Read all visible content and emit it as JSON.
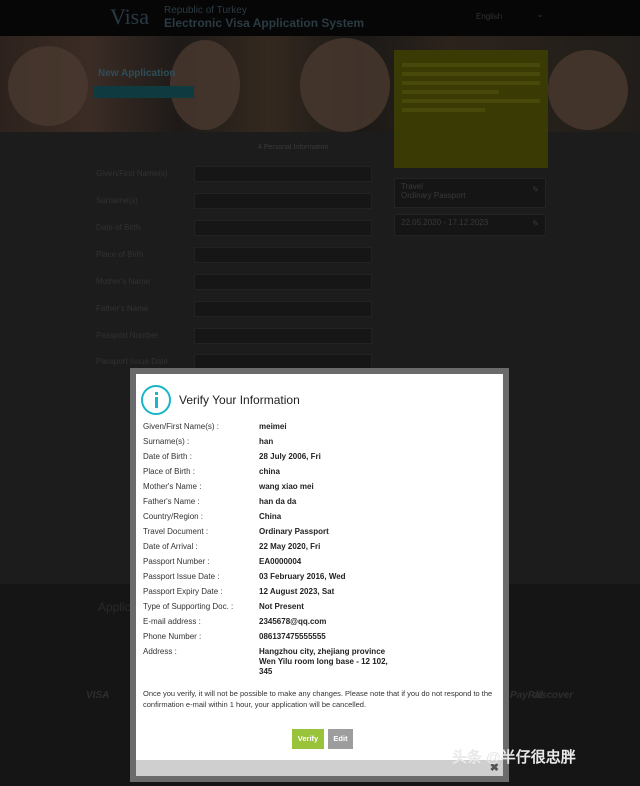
{
  "header": {
    "brand": "Visa",
    "republic": "Republic of Turkey",
    "system": "Electronic Visa Application System",
    "language": "English"
  },
  "banner": {
    "title": "New Application"
  },
  "breadcrumb": "4 Personal Information",
  "form": {
    "labels": [
      "Given/First Name(s)",
      "Surname(s)",
      "Date of Birth",
      "Place of Birth",
      "Mother's Name",
      "Father's Name",
      "Passport Number",
      "Passport Issue Date",
      "Passport Expiry Date",
      "Type of Supporting Doc.",
      "E-mail address",
      "Phone Number",
      "Address"
    ],
    "values": [
      "meimei",
      "han",
      "28 July 2006, Fri",
      "china",
      "wang xiao mei",
      "han da da",
      "EA0000004",
      "03 February 2016, Wed",
      "",
      "",
      "",
      "",
      ""
    ]
  },
  "side": {
    "travel_doc_label": "Travel",
    "travel_doc_value": "Ordinary Passport",
    "dates": "22.05.2020 - 17.12.2023"
  },
  "footer": {
    "title": "Application",
    "payments": [
      "VISA",
      "MasterCard",
      "PayPal",
      "discover"
    ]
  },
  "modal": {
    "title": "Verify Your Information",
    "rows": [
      {
        "label": "Given/First Name(s) :",
        "value": "meimei"
      },
      {
        "label": "Surname(s) :",
        "value": "han"
      },
      {
        "label": "Date of Birth :",
        "value": "28 July 2006, Fri"
      },
      {
        "label": "Place of Birth :",
        "value": "china"
      },
      {
        "label": "Mother's Name :",
        "value": "wang xiao mei"
      },
      {
        "label": "Father's Name :",
        "value": "han da da"
      },
      {
        "label": "Country/Region :",
        "value": "China"
      },
      {
        "label": "Travel Document :",
        "value": "Ordinary Passport"
      },
      {
        "label": "Date of Arrival :",
        "value": "22 May 2020, Fri"
      },
      {
        "label": "Passport Number :",
        "value": "EA0000004"
      },
      {
        "label": "Passport Issue Date :",
        "value": "03 February 2016, Wed"
      },
      {
        "label": "Passport Expiry Date :",
        "value": "12 August 2023, Sat"
      },
      {
        "label": "Type of Supporting Doc. :",
        "value": "Not Present"
      },
      {
        "label": "E-mail address :",
        "value": "2345678@qq.com"
      },
      {
        "label": "Phone Number :",
        "value": "086137475555555"
      },
      {
        "label": "Address :",
        "value": "Hangzhou city, zhejiang province Wen Yilu room long base - 12 102, 345"
      }
    ],
    "notice": "Once you verify, it will not be possible to make any changes. Please note that if you do not respond to the confirmation e-mail within 1 hour, your application will be cancelled.",
    "verify_label": "Verify",
    "edit_label": "Edit",
    "close_label": "✖"
  },
  "watermark": "头条 @半仔很忠胖",
  "colors": {
    "accent": "#18b6c6",
    "verify": "#9ac33c",
    "edit": "#9d9d9d"
  }
}
